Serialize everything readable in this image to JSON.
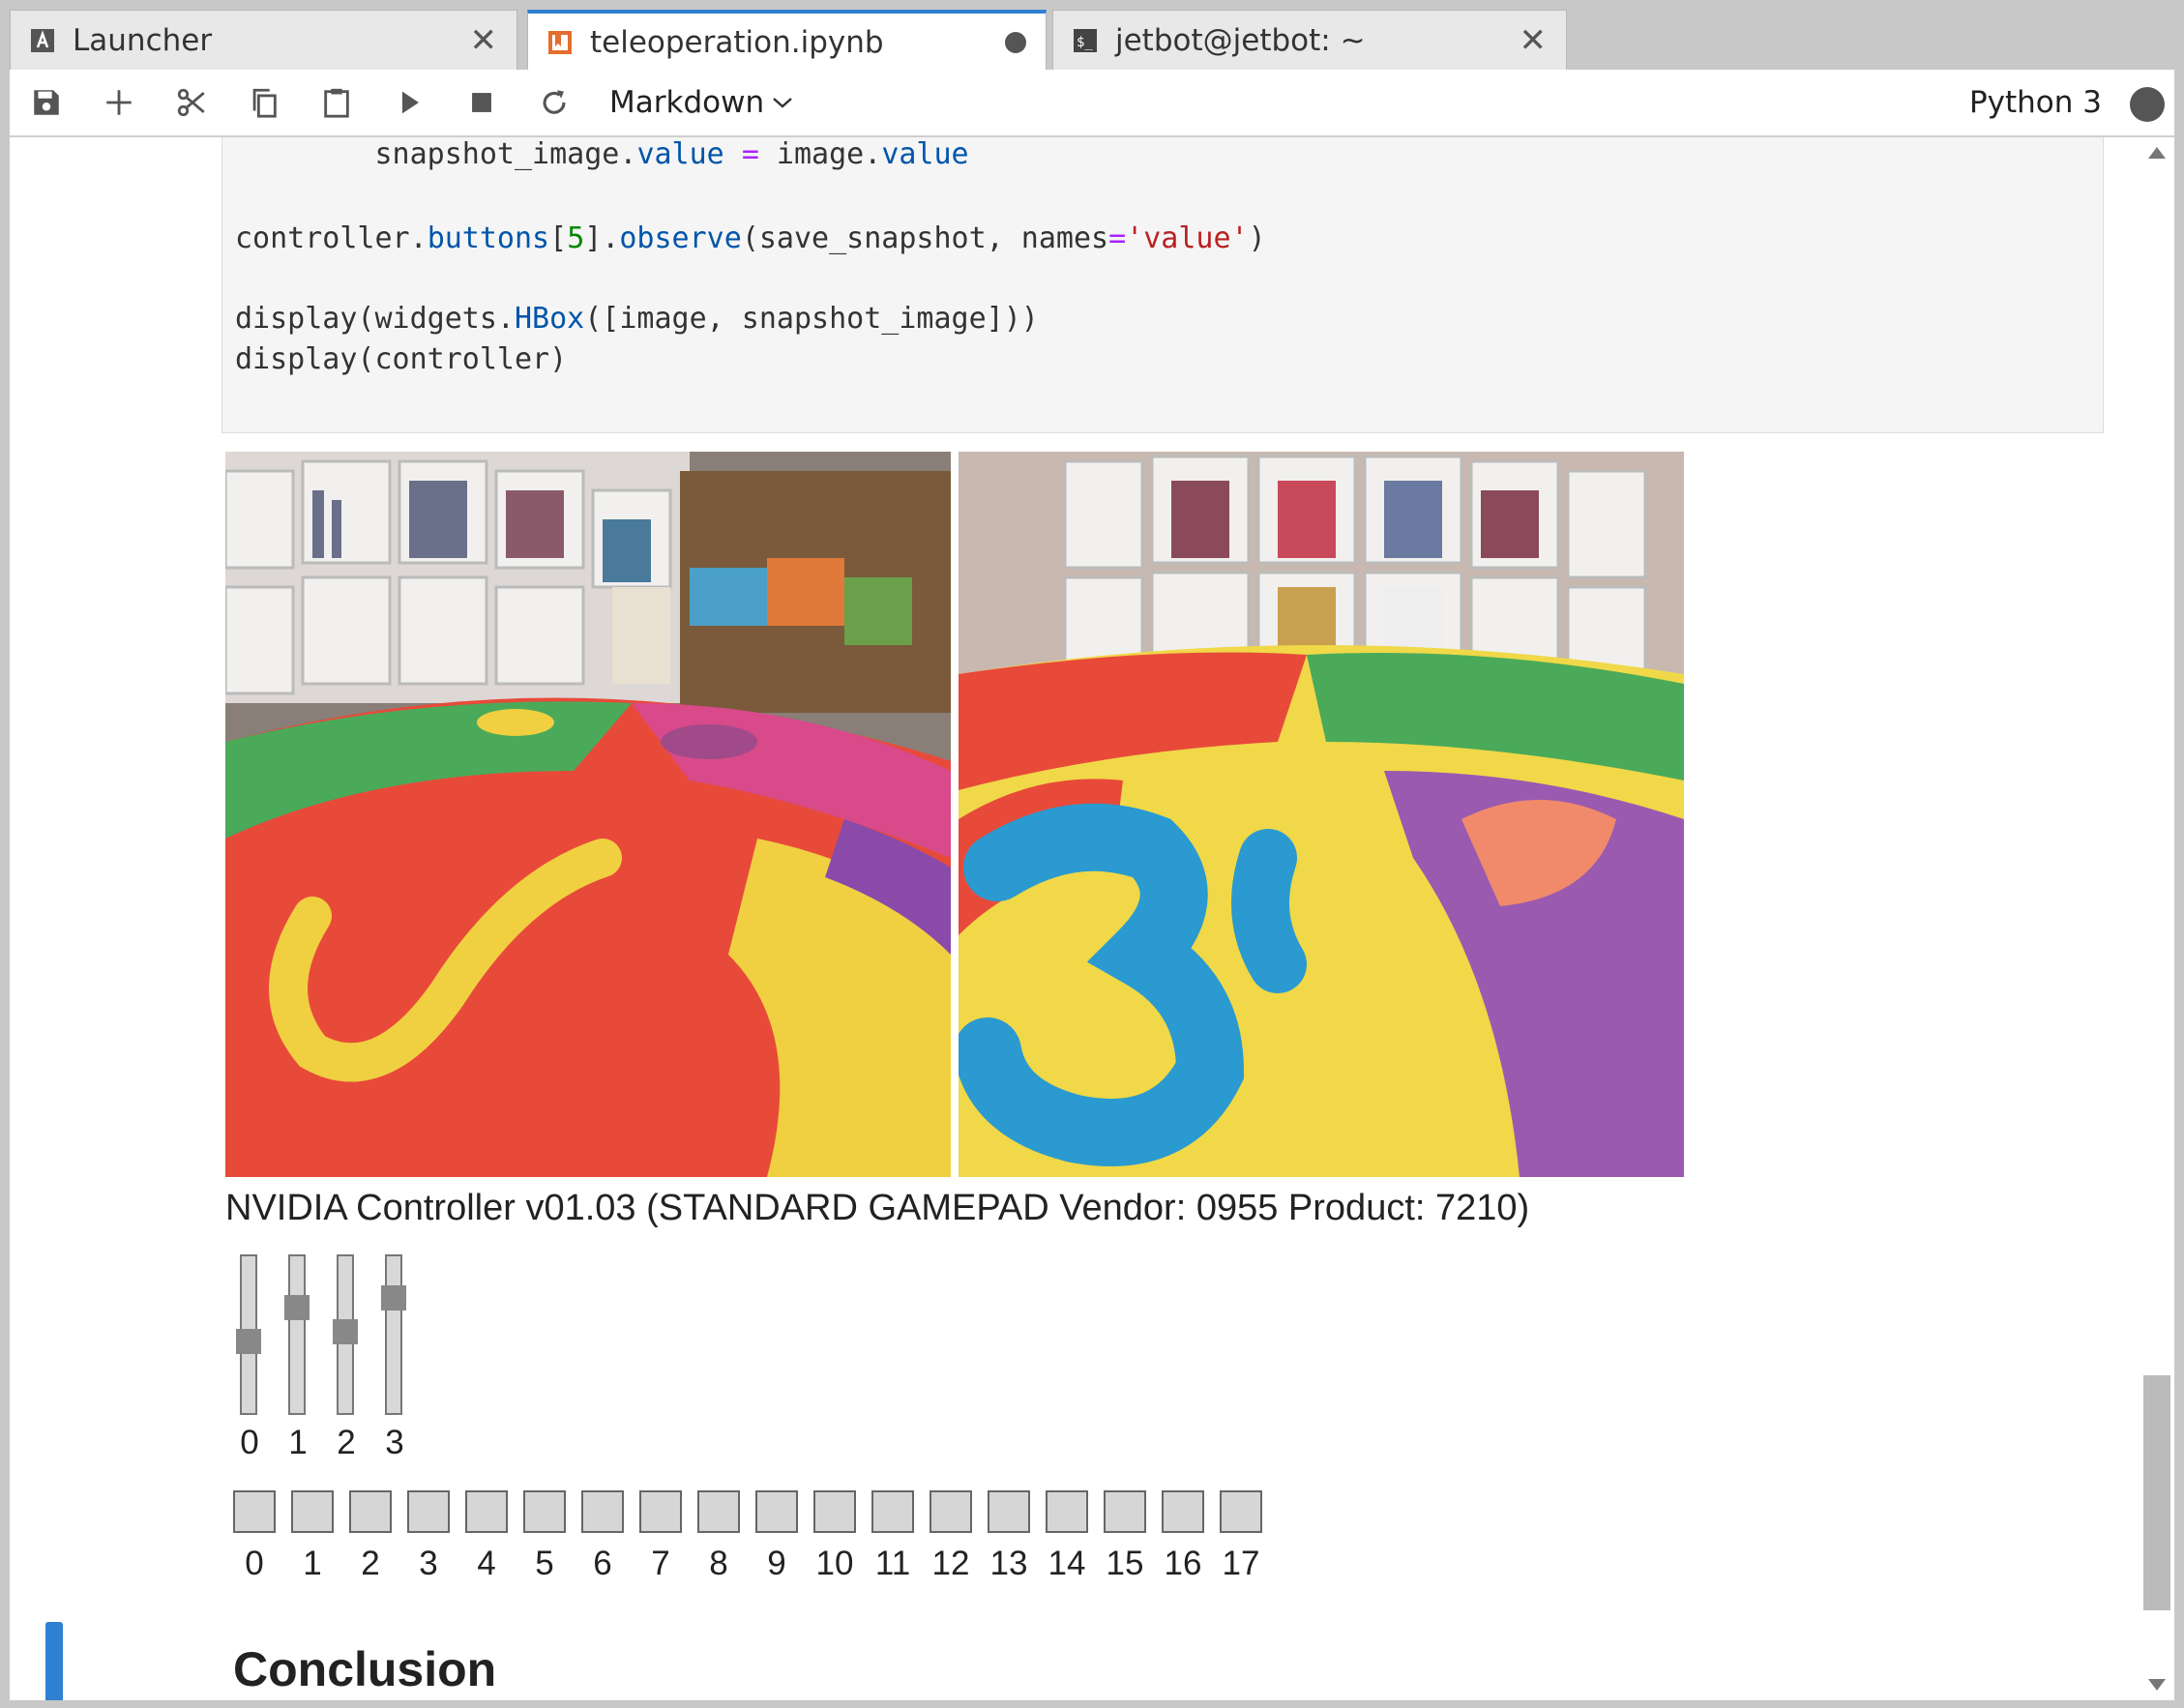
{
  "tabs": [
    {
      "label": "Launcher",
      "icon": "launcher-icon",
      "close": "✕"
    },
    {
      "label": "teleoperation.ipynb",
      "icon": "notebook-icon",
      "active": true
    },
    {
      "label": "jetbot@jetbot: ~",
      "icon": "terminal-icon",
      "close": "✕"
    }
  ],
  "toolbar": {
    "cell_type": "Markdown",
    "kernel": "Python 3"
  },
  "code": {
    "line1": {
      "indent": "        ",
      "a": "snapshot_image.",
      "b": "value",
      "c": " ",
      "d": "=",
      "e": " image.",
      "f": "value"
    },
    "line2": {
      "a": "controller.",
      "b": "buttons",
      "c": "[",
      "d": "5",
      "e": "].",
      "f": "observe",
      "g": "(save_snapshot, names",
      "h": "=",
      "i": "'value'",
      "j": ")"
    },
    "line3": {
      "a": "display(widgets.",
      "b": "HBox",
      "c": "([image, snapshot_image]))"
    },
    "line4": "display(controller)"
  },
  "controller": {
    "title": "NVIDIA Controller v01.03 (STANDARD GAMEPAD Vendor: 0955 Product: 7210)",
    "axes": [
      {
        "label": "0",
        "value": 0.1
      },
      {
        "label": "1",
        "value": -0.4
      },
      {
        "label": "2",
        "value": -0.05
      },
      {
        "label": "3",
        "value": -0.55
      }
    ],
    "buttons": [
      "0",
      "1",
      "2",
      "3",
      "4",
      "5",
      "6",
      "7",
      "8",
      "9",
      "10",
      "11",
      "12",
      "13",
      "14",
      "15",
      "16",
      "17"
    ]
  },
  "markdown": {
    "heading": "Conclusion"
  },
  "colors": {
    "accent": "#2f80d1",
    "notebook_icon": "#e46e2e"
  }
}
